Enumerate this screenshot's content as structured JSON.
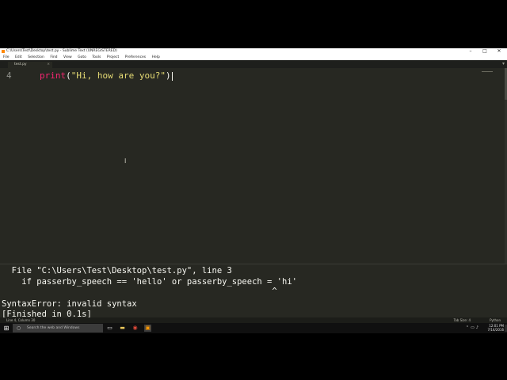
{
  "window": {
    "title": "C:\\Users\\Test\\Desktop\\test.py - Sublime Text (UNREGISTERED)",
    "controls": {
      "minimize": "–",
      "maximize": "□",
      "close": "✕"
    }
  },
  "menu": {
    "items": [
      "File",
      "Edit",
      "Selection",
      "Find",
      "View",
      "Goto",
      "Tools",
      "Project",
      "Preferences",
      "Help"
    ]
  },
  "tabs": [
    {
      "label": "test.py",
      "close": "×"
    }
  ],
  "editor": {
    "line_number": "4",
    "code": {
      "func": "print",
      "open": "(",
      "string": "\"Hi, how are you?\"",
      "close": ")"
    }
  },
  "console": {
    "lines": [
      "  File \"C:\\Users\\Test\\Desktop\\test.py\", line 3",
      "    if passerby_speech == 'hello' or passerby_speech = 'hi'",
      "                                                      ^",
      "SyntaxError: invalid syntax",
      "[Finished in 0.1s]"
    ]
  },
  "statusbar": {
    "position": "Line 4, Column 30",
    "tab_size": "Tab Size: 4",
    "syntax": "Python"
  },
  "taskbar": {
    "search_placeholder": "Search the web and Windows",
    "time": "12:01 PM",
    "date": "7/14/2016"
  },
  "colors": {
    "editor_bg": "#272822",
    "keyword": "#f92672",
    "string": "#e6db74",
    "default_text": "#f8f8f2"
  }
}
